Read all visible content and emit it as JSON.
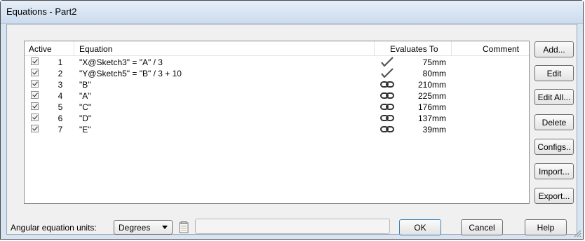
{
  "window": {
    "title": "Equations - Part2"
  },
  "table": {
    "columns": {
      "active": "Active",
      "equation": "Equation",
      "evaluates_to": "Evaluates To",
      "comment": "Comment"
    },
    "rows": [
      {
        "active": true,
        "num": "1",
        "equation": "\"X@Sketch3\" = \"A\" / 3",
        "status_icon": "check-icon",
        "value": "75mm",
        "comment": ""
      },
      {
        "active": true,
        "num": "2",
        "equation": "\"Y@Sketch5\" = \"B\" / 3 + 10",
        "status_icon": "check-icon",
        "value": "80mm",
        "comment": ""
      },
      {
        "active": true,
        "num": "3",
        "equation": "\"B\"",
        "status_icon": "link-icon",
        "value": "210mm",
        "comment": ""
      },
      {
        "active": true,
        "num": "4",
        "equation": "\"A\"",
        "status_icon": "link-icon",
        "value": "225mm",
        "comment": ""
      },
      {
        "active": true,
        "num": "5",
        "equation": "\"C\"",
        "status_icon": "link-icon",
        "value": "176mm",
        "comment": ""
      },
      {
        "active": true,
        "num": "6",
        "equation": "\"D\"",
        "status_icon": "link-icon",
        "value": "137mm",
        "comment": ""
      },
      {
        "active": true,
        "num": "7",
        "equation": "\"E\"",
        "status_icon": "link-icon",
        "value": "39mm",
        "comment": ""
      }
    ]
  },
  "side_buttons": {
    "add": "Add...",
    "edit": "Edit",
    "edit_all": "Edit All...",
    "delete": "Delete",
    "configs": "Configs..",
    "import": "Import...",
    "export": "Export..."
  },
  "bottom": {
    "angular_label": "Angular equation units:",
    "angular_value": "Degrees",
    "ok": "OK",
    "cancel": "Cancel",
    "help": "Help"
  }
}
